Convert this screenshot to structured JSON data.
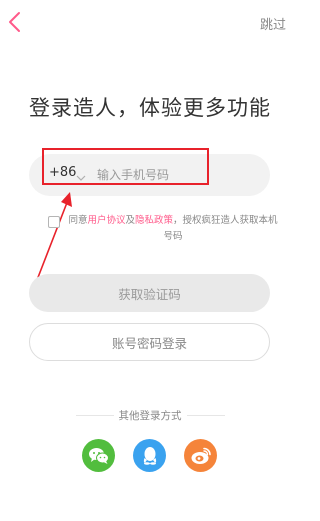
{
  "header": {
    "skip_label": "跳过"
  },
  "main": {
    "title": "登录造人，体验更多功能"
  },
  "phone": {
    "country_code": "+86",
    "placeholder": "输入手机号码"
  },
  "agreement": {
    "prefix": "同意",
    "user_agreement": "用户协议",
    "conjunction": "及",
    "privacy_policy": "隐私政策",
    "suffix": "，授权疯狂造人获取本机号码"
  },
  "buttons": {
    "get_code": "获取验证码",
    "password_login": "账号密码登录"
  },
  "other_login": {
    "label": "其他登录方式",
    "providers": [
      "wechat",
      "qq",
      "weibo"
    ]
  },
  "colors": {
    "accent": "#ff5a8a",
    "annotation": "#e8222b",
    "wechat": "#52bd3e",
    "qq": "#3aa2ef",
    "weibo": "#f5843a"
  },
  "icons": {
    "back": "chevron-left-icon",
    "country_dropdown": "chevron-down-icon",
    "wechat": "wechat-icon",
    "qq": "qq-icon",
    "weibo": "weibo-icon"
  }
}
